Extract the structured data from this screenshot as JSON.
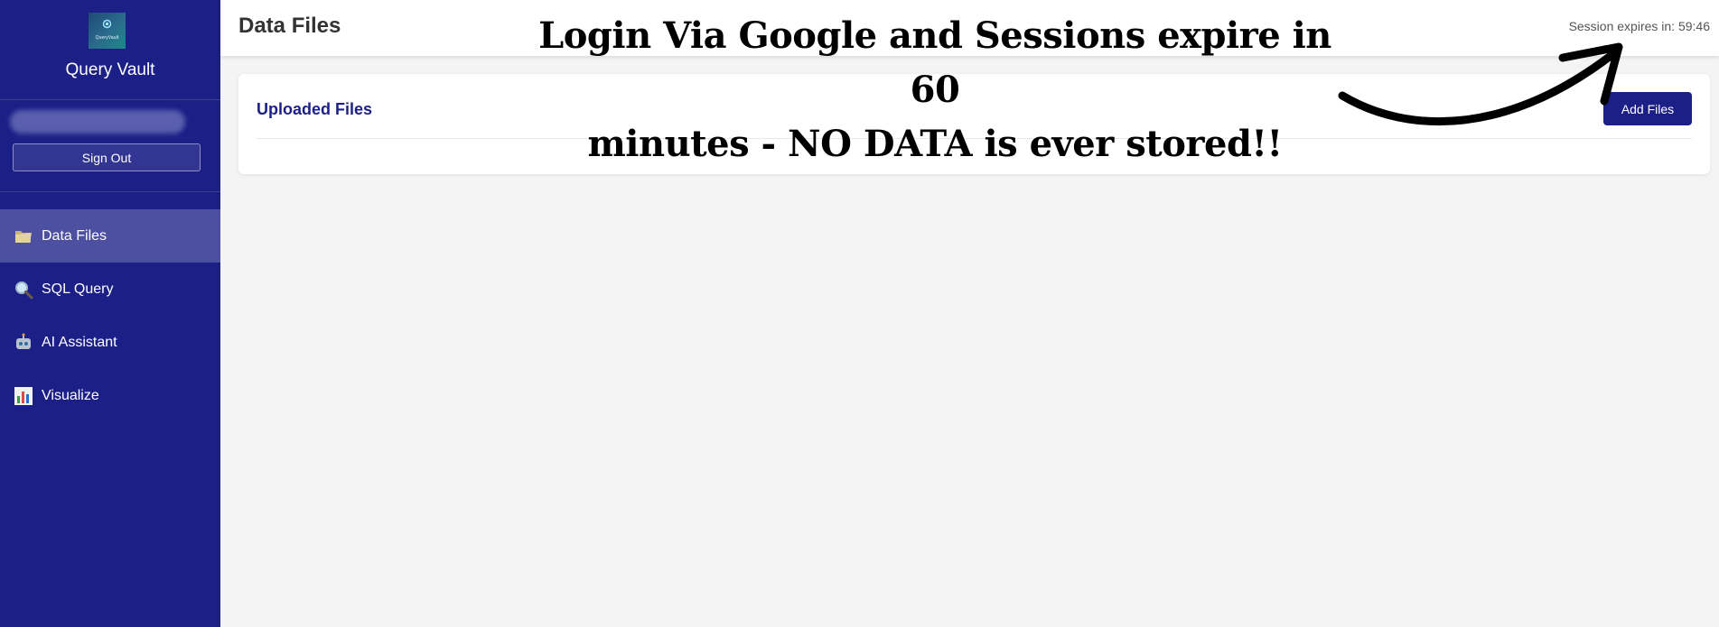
{
  "sidebar": {
    "brand_name": "Query Vault",
    "logo_text": "QueryVault",
    "signout_label": "Sign Out",
    "items": [
      {
        "label": "Data Files",
        "icon": "folder-icon",
        "active": true
      },
      {
        "label": "SQL Query",
        "icon": "magnifier-icon",
        "active": false
      },
      {
        "label": "AI Assistant",
        "icon": "robot-icon",
        "active": false
      },
      {
        "label": "Visualize",
        "icon": "bar-chart-icon",
        "active": false
      }
    ]
  },
  "header": {
    "title": "Data Files",
    "session_text": "Session expires in: 59:46"
  },
  "main": {
    "card_title": "Uploaded Files",
    "add_files_label": "Add Files"
  },
  "annotation": {
    "line1": "Login Via Google and Sessions expire in 60",
    "line2": "minutes - NO DATA is ever stored!!"
  },
  "colors": {
    "sidebar_bg": "#1b1f86",
    "accent": "#1b1f86",
    "page_bg": "#f4f4f4"
  }
}
